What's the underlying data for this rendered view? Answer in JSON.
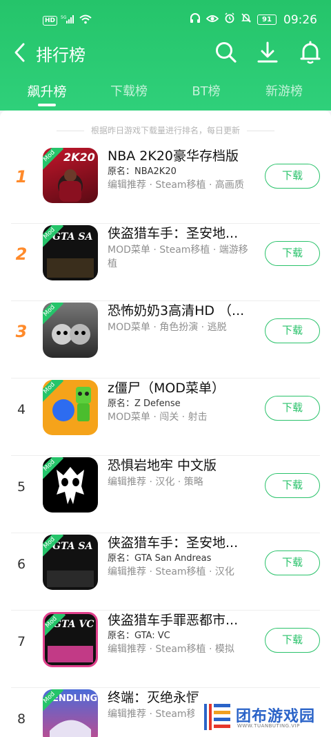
{
  "status_bar": {
    "hd": "HD",
    "signal": "5G",
    "battery": "91",
    "time": "09:26"
  },
  "header": {
    "title": "排行榜",
    "icons": [
      "back-icon",
      "search-icon",
      "download-icon",
      "bell-icon"
    ],
    "color": "#25c46a"
  },
  "tabs": [
    {
      "label": "飙升榜",
      "active": true
    },
    {
      "label": "下载榜",
      "active": false
    },
    {
      "label": "BT榜",
      "active": false
    },
    {
      "label": "新游榜",
      "active": false
    }
  ],
  "notice": "根据昨日游戏下载量进行排名，每日更新",
  "items": [
    {
      "rank": "1",
      "name": "NBA 2K20豪华存档版",
      "orig": "原名：NBA2K20",
      "tags": "编辑推荐 · Steam移植 · 高画质",
      "button": "下载",
      "mod": "Mod",
      "icon_text": "2K20"
    },
    {
      "rank": "2",
      "name": "侠盗猎车手：圣安地...",
      "orig": "",
      "tags": "MOD菜单 · Steam移植 · 端游移植",
      "button": "下载",
      "mod": "Mod",
      "icon_text": "GTA SA"
    },
    {
      "rank": "3",
      "name": "恐怖奶奶3高清HD （...",
      "orig": "",
      "tags": "MOD菜单 · 角色扮演 · 逃脱",
      "button": "下载",
      "mod": "Mod",
      "icon_text": "Granny"
    },
    {
      "rank": "4",
      "name": "z僵尸（MOD菜单）",
      "orig": "原名：Z Defense",
      "tags": "MOD菜单 · 闯关 · 射击",
      "button": "下载",
      "mod": "Mod",
      "icon_text": "Z"
    },
    {
      "rank": "5",
      "name": "恐惧岩地牢 中文版",
      "orig": "",
      "tags": "编辑推荐 · 汉化 · 策略",
      "button": "下载",
      "mod": "Mod",
      "icon_text": "skull"
    },
    {
      "rank": "6",
      "name": "侠盗猎车手：圣安地...",
      "orig": "原名：GTA San Andreas",
      "tags": "编辑推荐 · Steam移植 · 汉化",
      "button": "下载",
      "mod": "Mod",
      "icon_text": "GTA SA"
    },
    {
      "rank": "7",
      "name": "侠盗猎车手罪恶都市...",
      "orig": "原名：GTA: VC",
      "tags": "编辑推荐 · Steam移植 · 模拟",
      "button": "下载",
      "mod": "Mod",
      "icon_text": "GTA VC"
    },
    {
      "rank": "8",
      "name": "终端：灭绝永恒",
      "orig": "",
      "tags": "编辑推荐 · Steam移植 · 游戏",
      "button": "下载",
      "mod": "Mod",
      "icon_text": "ENDLING"
    }
  ],
  "watermark": {
    "title": "团布游戏园",
    "sub": "WWW.TUANBUTING.VIP"
  }
}
